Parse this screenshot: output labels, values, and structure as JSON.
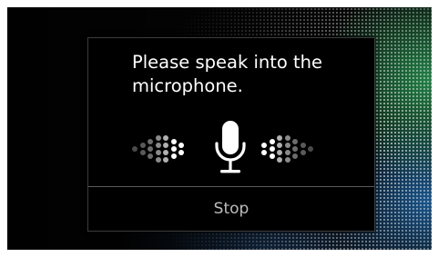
{
  "dialog": {
    "prompt": "Please speak into the microphone.",
    "stop_label": "Stop"
  },
  "icons": {
    "microphone": "microphone-icon",
    "level_left": "audio-level-left-icon",
    "level_right": "audio-level-right-icon"
  },
  "colors": {
    "dialog_background": "#000000",
    "prompt_text": "#ffffff",
    "stop_text": "#bdbdbd",
    "background_accent_green": "#28aa5a",
    "background_accent_blue": "#1e78c8"
  }
}
